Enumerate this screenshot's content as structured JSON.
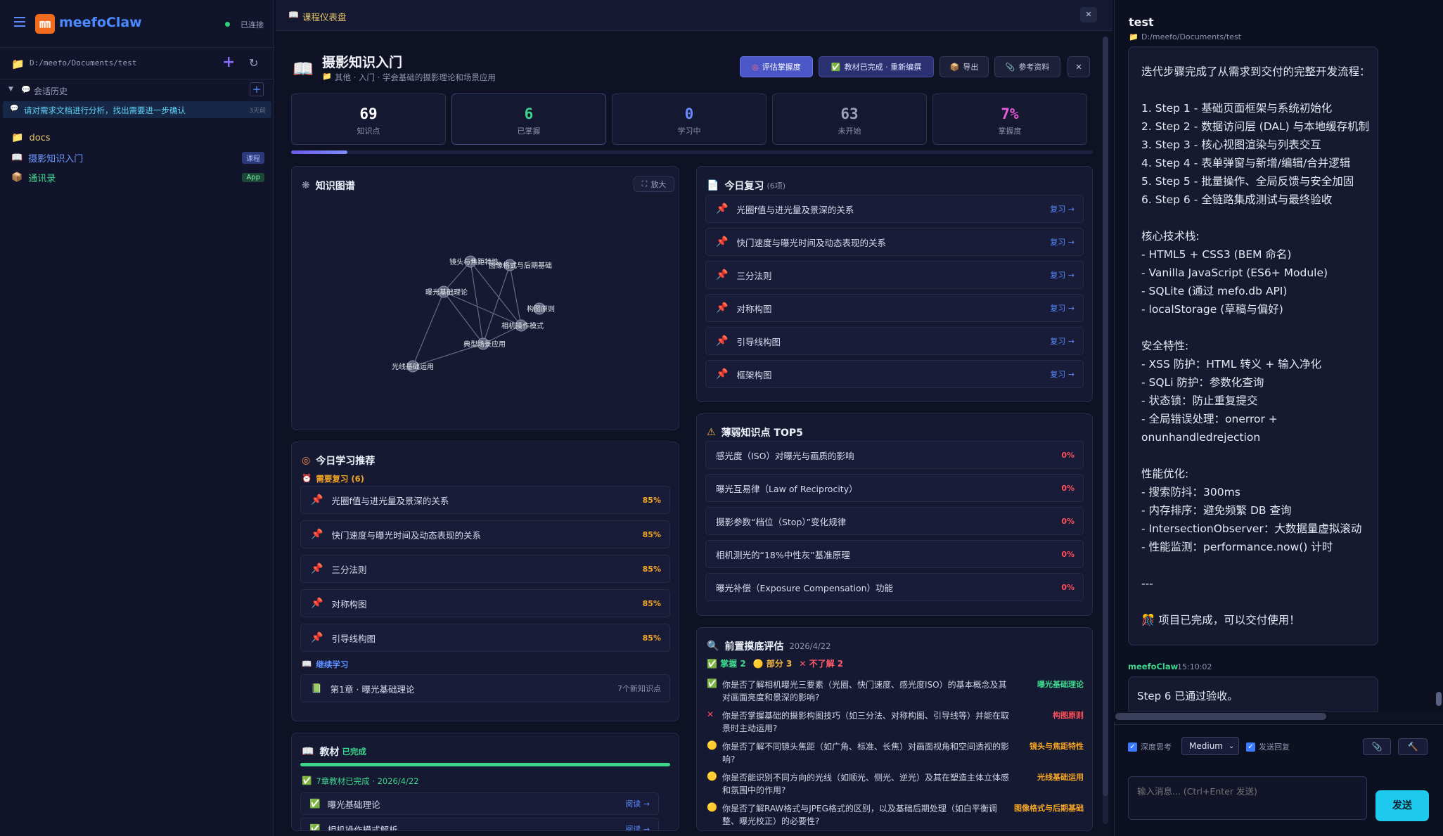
{
  "app": {
    "name": "meefoClaw",
    "status": "已连接"
  },
  "sidebar": {
    "path": "D:/meefo/Documents/test",
    "history_label": "会话历史",
    "history_item": "请对需求文档进行分析，找出需要进一步确认",
    "history_time": "3天前",
    "items": [
      {
        "label": "docs"
      },
      {
        "label": "摄影知识入门",
        "tag": "课程"
      },
      {
        "label": "通讯录",
        "tag": "App"
      }
    ]
  },
  "tab": {
    "title": "课程仪表盘"
  },
  "course": {
    "title": "摄影知识入门",
    "subtitle": "其他 · 入门 · 学会基础的摄影理论和场景应用",
    "buttons": {
      "assess": "评估掌握度",
      "done": "教材已完成 · 重新编撰",
      "export": "导出",
      "refs": "参考资料"
    }
  },
  "stats": [
    {
      "value": "69",
      "label": "知识点",
      "color": "#ffffff"
    },
    {
      "value": "6",
      "label": "已掌握",
      "color": "#3dd68c"
    },
    {
      "value": "0",
      "label": "学习中",
      "color": "#6c8bff"
    },
    {
      "value": "63",
      "label": "未开始",
      "color": "#9aa0b8"
    },
    {
      "value": "7%",
      "label": "掌握度",
      "color": "#e85ad8"
    }
  ],
  "progress": 7,
  "graph": {
    "title": "知识图谱",
    "zoom": "放大",
    "nodes": [
      "镜头与焦距特性",
      "图像格式与后期基础",
      "曝光基础理论",
      "构图原则",
      "相机操作模式",
      "典型场景应用",
      "光线基础运用"
    ]
  },
  "review": {
    "title": "今日复习",
    "count": "(6项)",
    "action": "复习 →",
    "items": [
      "光圈f值与进光量及景深的关系",
      "快门速度与曝光时间及动态表现的关系",
      "三分法则",
      "对称构图",
      "引导线构图",
      "框架构图"
    ]
  },
  "weak": {
    "title": "薄弱知识点 TOP5",
    "items": [
      {
        "label": "感光度（ISO）对曝光与画质的影响",
        "pct": "0%"
      },
      {
        "label": "曝光互易律（Law of Reciprocity）",
        "pct": "0%"
      },
      {
        "label": "摄影参数“档位（Stop）”变化规律",
        "pct": "0%"
      },
      {
        "label": "相机测光的“18%中性灰”基准原理",
        "pct": "0%"
      },
      {
        "label": "曝光补偿（Exposure Compensation）功能",
        "pct": "0%"
      }
    ]
  },
  "recommend": {
    "title": "今日学习推荐",
    "need_review": "需要复习 (6)",
    "items": [
      {
        "label": "光圈f值与进光量及景深的关系",
        "pct": "85%"
      },
      {
        "label": "快门速度与曝光时间及动态表现的关系",
        "pct": "85%"
      },
      {
        "label": "三分法则",
        "pct": "85%"
      },
      {
        "label": "对称构图",
        "pct": "85%"
      },
      {
        "label": "引导线构图",
        "pct": "85%"
      }
    ],
    "continue": "继续学习",
    "chapter": "第1章 · 曝光基础理论",
    "chapter_meta": "7个新知识点"
  },
  "textbook": {
    "title": "教材",
    "status": "已完成",
    "done": "7章教材已完成 · 2026/4/22",
    "chapters": [
      {
        "label": "曝光基础理论",
        "action": "阅读 →"
      },
      {
        "label": "相机操作模式解析",
        "action": "阅读 →"
      }
    ],
    "progress": 100
  },
  "assessment": {
    "title": "前置摸底评估",
    "date": "2026/4/22",
    "master": "掌握 2",
    "partial": "部分 3",
    "unknown": "不了解 2",
    "items": [
      {
        "text": "你是否了解相机曝光三要素（光圈、快门速度、感光度ISO）的基本概念及其对画面亮度和景深的影响?",
        "topic": "曝光基础理论",
        "state": "ok"
      },
      {
        "text": "你是否掌握基础的摄影构图技巧（如三分法、对称构图、引导线等）并能在取景时主动运用?",
        "topic": "构图原则",
        "state": "no"
      },
      {
        "text": "你是否了解不同镜头焦距（如广角、标准、长焦）对画面视角和空间透视的影响?",
        "topic": "镜头与焦距特性",
        "state": "part"
      },
      {
        "text": "你是否能识别不同方向的光线（如顺光、侧光、逆光）及其在塑造主体立体感和氛围中的作用?",
        "topic": "光线基础运用",
        "state": "part"
      },
      {
        "text": "你是否了解RAW格式与JPEG格式的区别，以及基础后期处理（如白平衡调整、曝光校正）的必要性?",
        "topic": "图像格式与后期基础",
        "state": "part"
      }
    ]
  },
  "chat": {
    "title": "test",
    "path": "D:/meefo/Documents/test",
    "message": "迭代步骤完成了从需求到交付的完整开发流程：\n\n1. Step 1 - 基础页面框架与系统初始化\n2. Step 2 - 数据访问层 (DAL) 与本地缓存机制\n3. Step 3 - 核心视图渲染与列表交互\n4. Step 4 - 表单弹窗与新增/编辑/合并逻辑\n5. Step 5 - 批量操作、全局反馈与安全加固\n6. Step 6 - 全链路集成测试与最终验收\n\n核心技术栈:\n- HTML5 + CSS3 (BEM 命名)\n- Vanilla JavaScript (ES6+ Module)\n- SQLite (通过 mefo.db API)\n- localStorage (草稿与偏好)\n\n安全特性:\n- XSS 防护：HTML 转义 + 输入净化\n- SQLi 防护：参数化查询\n- 状态锁：防止重复提交\n- 全局错误处理：onerror + onunhandledrejection\n\n性能优化:\n- 搜索防抖：300ms\n- 内存排序：避免频繁 DB 查询\n- IntersectionObserver：大数据量虚拟滚动\n- 性能监测：performance.now() 计时\n\n---\n\n🎊 项目已完成，可以交付使用！",
    "sender": "meefoClaw",
    "time": "15:10:02",
    "last": "Step 6 已通过验收。",
    "deep": "深度思考",
    "level": "Medium",
    "send_reply": "发送回复",
    "placeholder": "输入消息... (Ctrl+Enter 发送)",
    "send": "发送"
  }
}
